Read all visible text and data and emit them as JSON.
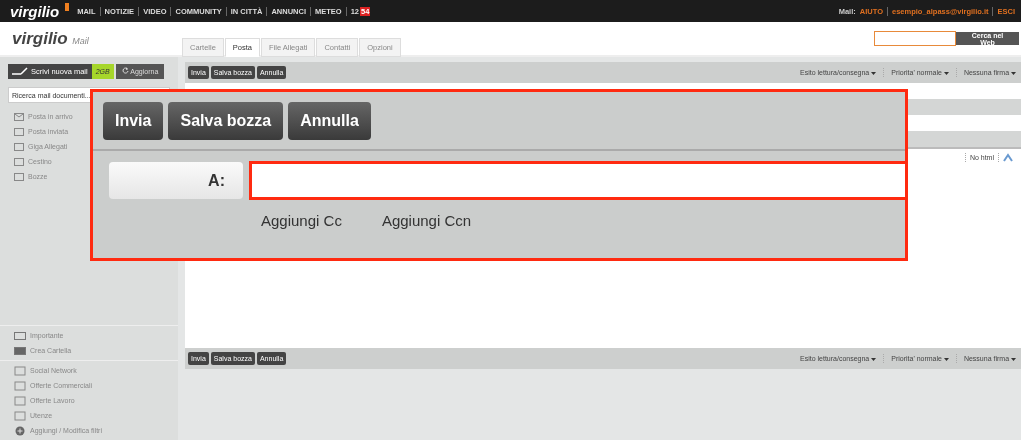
{
  "top_bar": {
    "logo": "virgilio",
    "nav": [
      "MAIL",
      "NOTIZIE",
      "VIDEO",
      "COMMUNITY",
      "IN CITTÀ",
      "ANNUNCI",
      "METEO"
    ],
    "clock": {
      "hour": "12",
      "minute": "54"
    },
    "mail_label": "Mail:",
    "links": [
      "AIUTO",
      "esempio_alpass@virgilio.it",
      "ESCI"
    ]
  },
  "header": {
    "logo": "virgilio",
    "logo_sub": "Mail",
    "tabs": [
      {
        "label": "Cartelle",
        "selected": false
      },
      {
        "label": "Posta",
        "selected": true
      },
      {
        "label": "File Allegati",
        "selected": false
      },
      {
        "label": "Contatti",
        "selected": false
      },
      {
        "label": "Opzioni",
        "selected": false
      }
    ],
    "search_button": "Cerca nel Web"
  },
  "sidebar": {
    "compose": "Scrivi nuova mail",
    "storage": "2GB",
    "refresh": "Aggiorna",
    "search": {
      "placeholder": "Ricerca mail documenti..."
    },
    "folders": [
      "Posta in arrivo",
      "Posta inviata",
      "Giga Allegati",
      "Cestino",
      "Bozze"
    ],
    "extras": [
      "Importante",
      "Crea Cartella"
    ],
    "tools": [
      "Social Network",
      "Offerte Commerciali",
      "Offerte Lavoro",
      "Utenze",
      "Aggiungi / Modifica filtri"
    ]
  },
  "toolbar": {
    "buttons": [
      "Invia",
      "Salva bozza",
      "Annulla"
    ],
    "menus": [
      "Esito lettura/consegna",
      "Priorita' normale",
      "Nessuna firma"
    ]
  },
  "editor": {
    "format": "No html"
  },
  "bottom_toolbar": {
    "buttons": [
      "Invia",
      "Salva bozza",
      "Annulla"
    ],
    "menus": [
      "Esito lettura/consegna",
      "Priorita' normale",
      "Nessuna firma"
    ]
  },
  "zoom_callout": {
    "buttons": [
      "Invia",
      "Salva bozza",
      "Annulla"
    ],
    "to_label": "A:",
    "links": [
      "Aggiungi Cc",
      "Aggiungi Ccn"
    ]
  }
}
